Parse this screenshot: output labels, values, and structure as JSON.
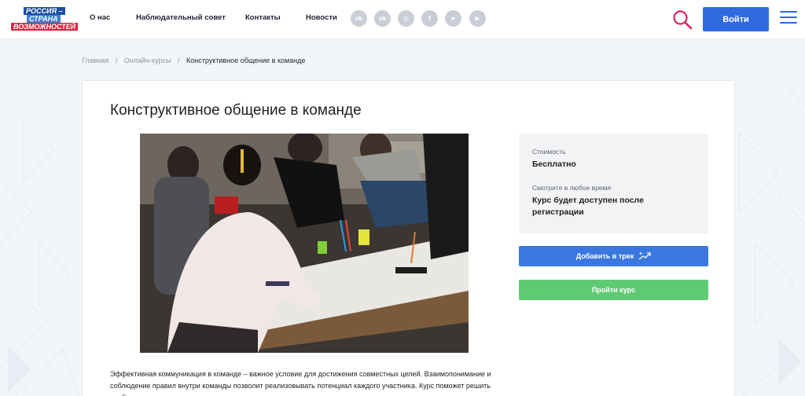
{
  "logo": {
    "line1": "РОССИЯ –",
    "line2": "СТРАНА",
    "line3": "ВОЗМОЖНОСТЕЙ"
  },
  "nav": {
    "items": [
      "О нас",
      "Наблюдательный совет",
      "Контакты",
      "Новости"
    ]
  },
  "social": [
    {
      "icon": "vk-icon",
      "glyph": "vk"
    },
    {
      "icon": "odnoklassniki-icon",
      "glyph": "ok"
    },
    {
      "icon": "instagram-icon",
      "glyph": "◎"
    },
    {
      "icon": "facebook-icon",
      "glyph": "f"
    },
    {
      "icon": "telegram-icon",
      "glyph": "➤"
    },
    {
      "icon": "youtube-icon",
      "glyph": "▶"
    }
  ],
  "header": {
    "login_label": "Войти"
  },
  "breadcrumbs": {
    "home": "Главная",
    "section": "Онлайн-курсы",
    "current": "Конструктивное общение в команде"
  },
  "course": {
    "title": "Конструктивное общение в команде",
    "description": "Эффективная коммуникация в команде – важное условие для достижения совместных целей. Взаимопонимание и соблюдение правил внутри команды позволит реализовывать потенциал каждого участника. Курс поможет решить проблемы в организации, устранив основную причину их возникновения –"
  },
  "info": {
    "price_label": "Стоимость",
    "price_value": "Бесплатно",
    "watch_label": "Смотрите в любое время",
    "watch_value": "Курс будет доступен после регистрации"
  },
  "actions": {
    "add_track_label": "Добавить в трек",
    "start_label": "Пройти курс"
  },
  "colors": {
    "accent": "#2f6be0",
    "green": "#5ecb73",
    "logo_red": "#d8263f",
    "search_pink": "#d6245a"
  }
}
